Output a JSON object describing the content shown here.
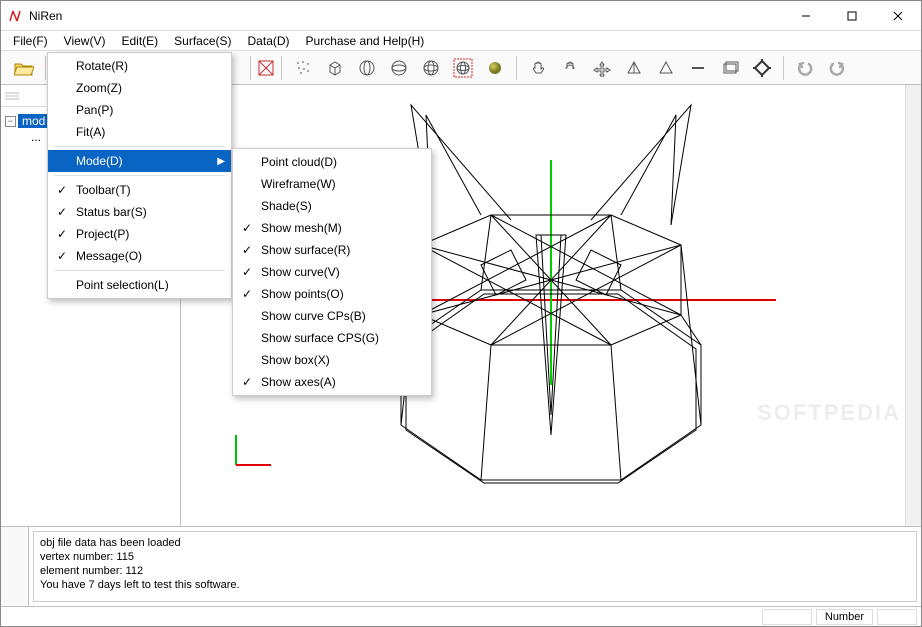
{
  "app": {
    "title": "NiRen"
  },
  "menubar": {
    "items": [
      "File(F)",
      "View(V)",
      "Edit(E)",
      "Surface(S)",
      "Data(D)",
      "Purchase and  Help(H)"
    ]
  },
  "view_menu": {
    "rotate": "Rotate(R)",
    "zoom": "Zoom(Z)",
    "pan": "Pan(P)",
    "fit": "Fit(A)",
    "mode": "Mode(D)",
    "toolbar": "Toolbar(T)",
    "statusbar": "Status bar(S)",
    "project": "Project(P)",
    "message": "Message(O)",
    "pointsel": "Point selection(L)"
  },
  "mode_menu": {
    "pointcloud": "Point cloud(D)",
    "wireframe": "Wireframe(W)",
    "shade": "Shade(S)",
    "showmesh": "Show mesh(M)",
    "showsurface": "Show surface(R)",
    "showcurve": "Show curve(V)",
    "showpoints": "Show points(O)",
    "showcurvecps": "Show curve CPs(B)",
    "showsurfacecps": "Show surface CPS(G)",
    "showbox": "Show box(X)",
    "showaxes": "Show axes(A)"
  },
  "tree": {
    "root": "mod",
    "child": "..."
  },
  "messages": {
    "l1": "obj file data has been loaded",
    "l2": "vertex number: 115",
    "l3": "element number: 112",
    "l4": "You have 7 days left to test this software."
  },
  "status": {
    "number_label": "Number"
  },
  "watermark": "SOFTPEDIA"
}
